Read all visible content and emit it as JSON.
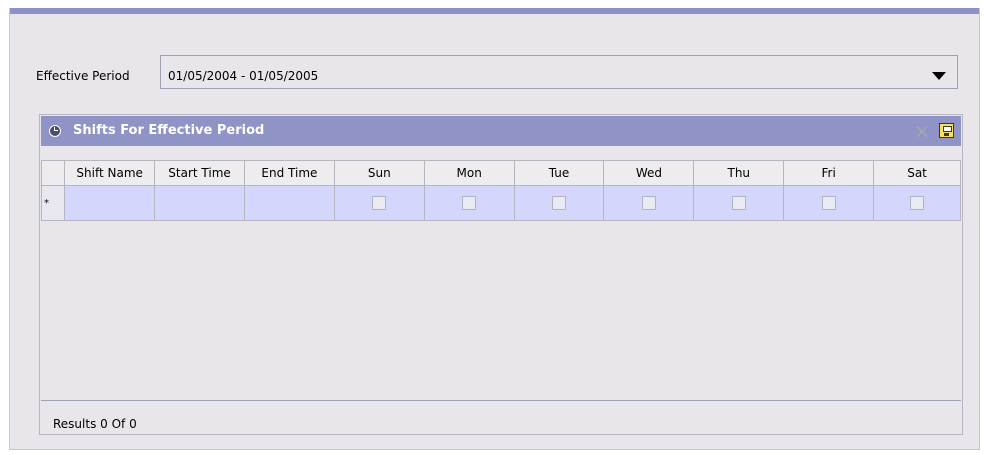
{
  "effective_period": {
    "label": "Effective Period",
    "value": "01/05/2004 - 01/05/2005"
  },
  "panel": {
    "title": "Shifts For Effective Period",
    "icons": {
      "header": "clock-icon",
      "delete": "delete-icon",
      "save": "save-icon"
    }
  },
  "table": {
    "headers": [
      "Shift Name",
      "Start Time",
      "End Time",
      "Sun",
      "Mon",
      "Tue",
      "Wed",
      "Thu",
      "Fri",
      "Sat"
    ],
    "new_row_marker": "*"
  },
  "footer": {
    "results": "Results 0  Of 0"
  },
  "colors": {
    "accent": "#8f93c5",
    "row_highlight": "#d4d7fb",
    "panel_bg": "#e8e6ea"
  }
}
